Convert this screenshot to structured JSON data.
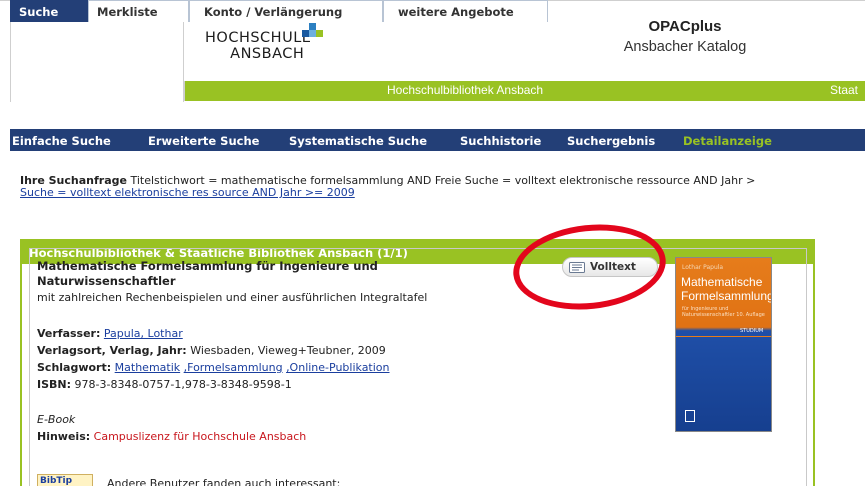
{
  "header": {
    "logo_line1": "HOCHSCHULE",
    "logo_line2": "ANSBACH",
    "opac_title": "OPACplus",
    "opac_subtitle": "Ansbacher Katalog",
    "library_label": "Hochschulbibliothek Ansbach",
    "staat_label": "Staat",
    "colors": {
      "green": "#99c223",
      "navy": "#233f77",
      "ring": "#e3061c"
    }
  },
  "tabs": [
    {
      "label": "Suche",
      "active": true
    },
    {
      "label": "Merkliste",
      "active": false
    },
    {
      "label": "Konto / Verlängerung",
      "active": false
    },
    {
      "label": "weitere Angebote",
      "active": false
    }
  ],
  "subnav": [
    {
      "label": "Einfache Suche"
    },
    {
      "label": "Erweiterte Suche"
    },
    {
      "label": "Systematische Suche"
    },
    {
      "label": "Suchhistorie"
    },
    {
      "label": "Suchergebnis"
    },
    {
      "label": "Detailanzeige"
    }
  ],
  "query": {
    "label": "Ihre Suchanfrage",
    "text": " Titelstichwort = mathematische formelsammlung AND Freie Suche = volltext elektronische ressource AND Jahr >",
    "continuation": "Suche = volltext elektronische res source AND Jahr >= 2009"
  },
  "result_box": {
    "heading": "Hochschulbibliothek & Staatliche Bibliothek Ansbach (1/1)"
  },
  "record": {
    "title": "Mathematische Formelsammlung für Ingenieure und Naturwissenschaftler",
    "subtitle": "mit zahlreichen Rechenbeispielen und einer ausführlichen Integraltafel",
    "author_label": "Verfasser:",
    "author": "Papula, Lothar",
    "publisher_label": "Verlagsort, Verlag, Jahr:",
    "publisher": "Wiesbaden, Vieweg+Teubner, 2009",
    "subject_label": "Schlagwort:",
    "subjects": [
      "Mathematik",
      ",Formelsammlung",
      ",Online-Publikation"
    ],
    "isbn_label": "ISBN:",
    "isbn": "978-3-8348-0757-1,978-3-8348-9598-1",
    "type": "E-Book",
    "hint_label": "Hinweis:",
    "hint": "Campuslizenz für Hochschule Ansbach",
    "fulltext_button": "Volltext",
    "fulltext_icon": "document-icon"
  },
  "cover": {
    "author": "Lothar Papula",
    "title": "Mathematische Formelsammlung",
    "tagline": "für Ingenieure und Naturwissenschaftler",
    "edition": "10. Auflage",
    "series": "STUDIUM"
  },
  "bibtip": {
    "badge": "BibTip",
    "text": "Andere Benutzer fanden auch interessant:"
  }
}
